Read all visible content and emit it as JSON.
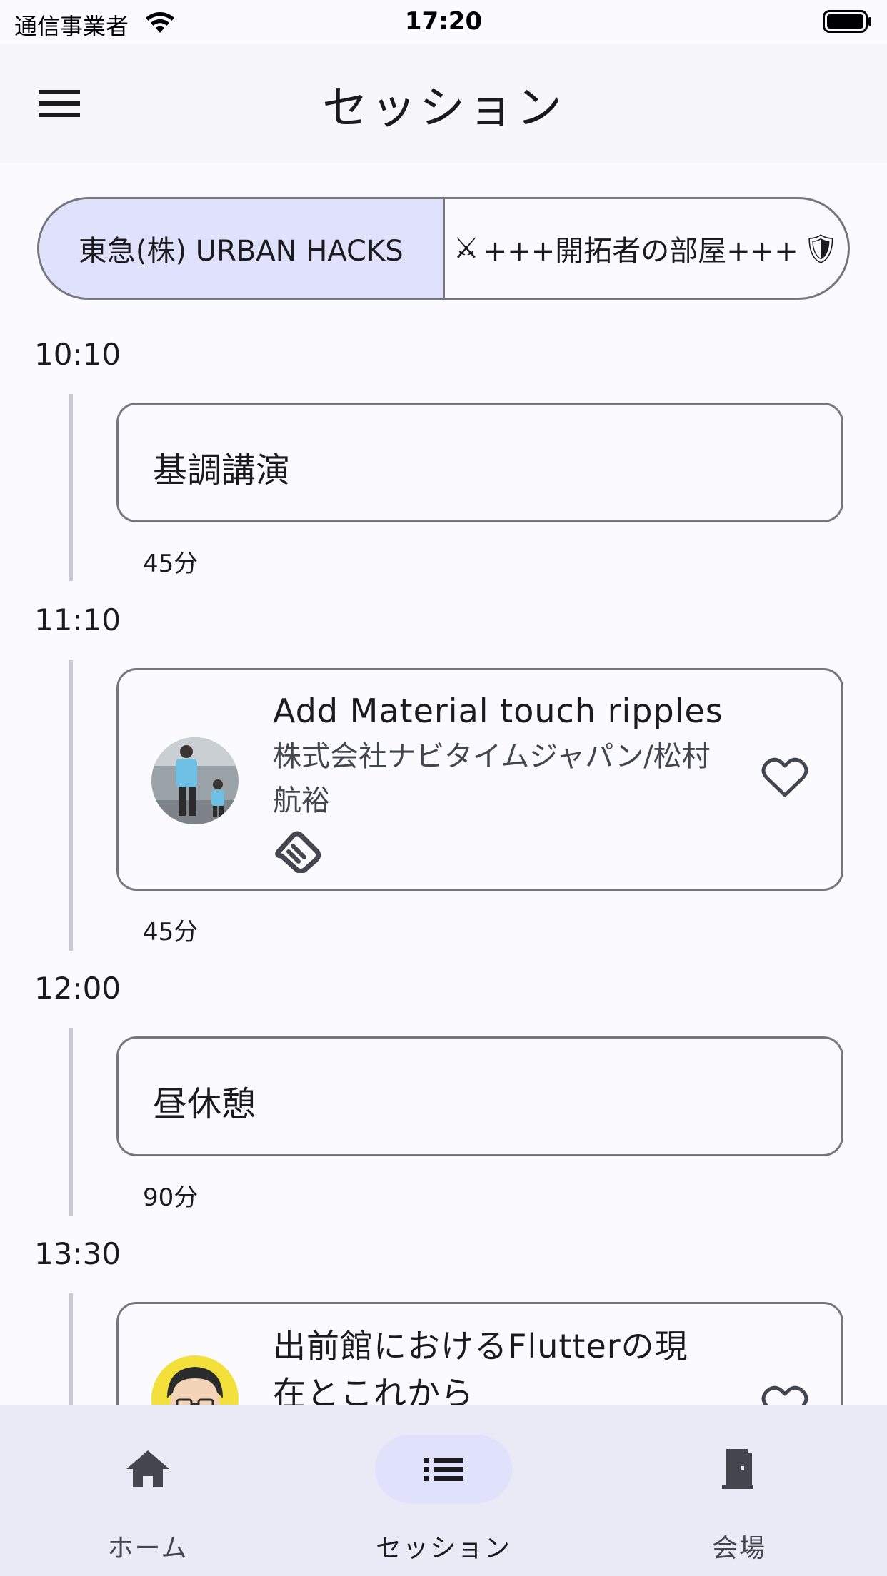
{
  "status_bar": {
    "carrier": "通信事業者",
    "time": "17:20"
  },
  "app_bar": {
    "title": "セッション"
  },
  "rooms": [
    {
      "label": "東急(株) URBAN HACKS",
      "selected": true
    },
    {
      "prefix_emoji": "⚔",
      "label": "+++開拓者の部屋+++",
      "suffix_emoji": "🛡",
      "selected": false
    }
  ],
  "timeline": [
    {
      "time": "10:10",
      "title": "基調講演",
      "duration": "45分"
    },
    {
      "time": "11:10",
      "title": "Add Material touch ripples",
      "speaker": "株式会社ナビタイムジャパン/松村　航裕",
      "duration": "45分",
      "favorite": false,
      "icon": "handshake-icon"
    },
    {
      "time": "12:00",
      "title": "昼休憩",
      "duration": "90分"
    },
    {
      "time": "13:30",
      "title": "出前館におけるFlutterの現在とこれから",
      "favorite": false
    }
  ],
  "bottom_nav": [
    {
      "label": "ホーム",
      "icon": "home-icon",
      "active": false
    },
    {
      "label": "セッション",
      "icon": "list-icon",
      "active": true
    },
    {
      "label": "会場",
      "icon": "door-icon",
      "active": false
    }
  ],
  "colors": {
    "accent_container": "#dfe2fa",
    "nav_background": "#e8ebf6",
    "outline": "#767680",
    "background": "#fbfaff"
  }
}
